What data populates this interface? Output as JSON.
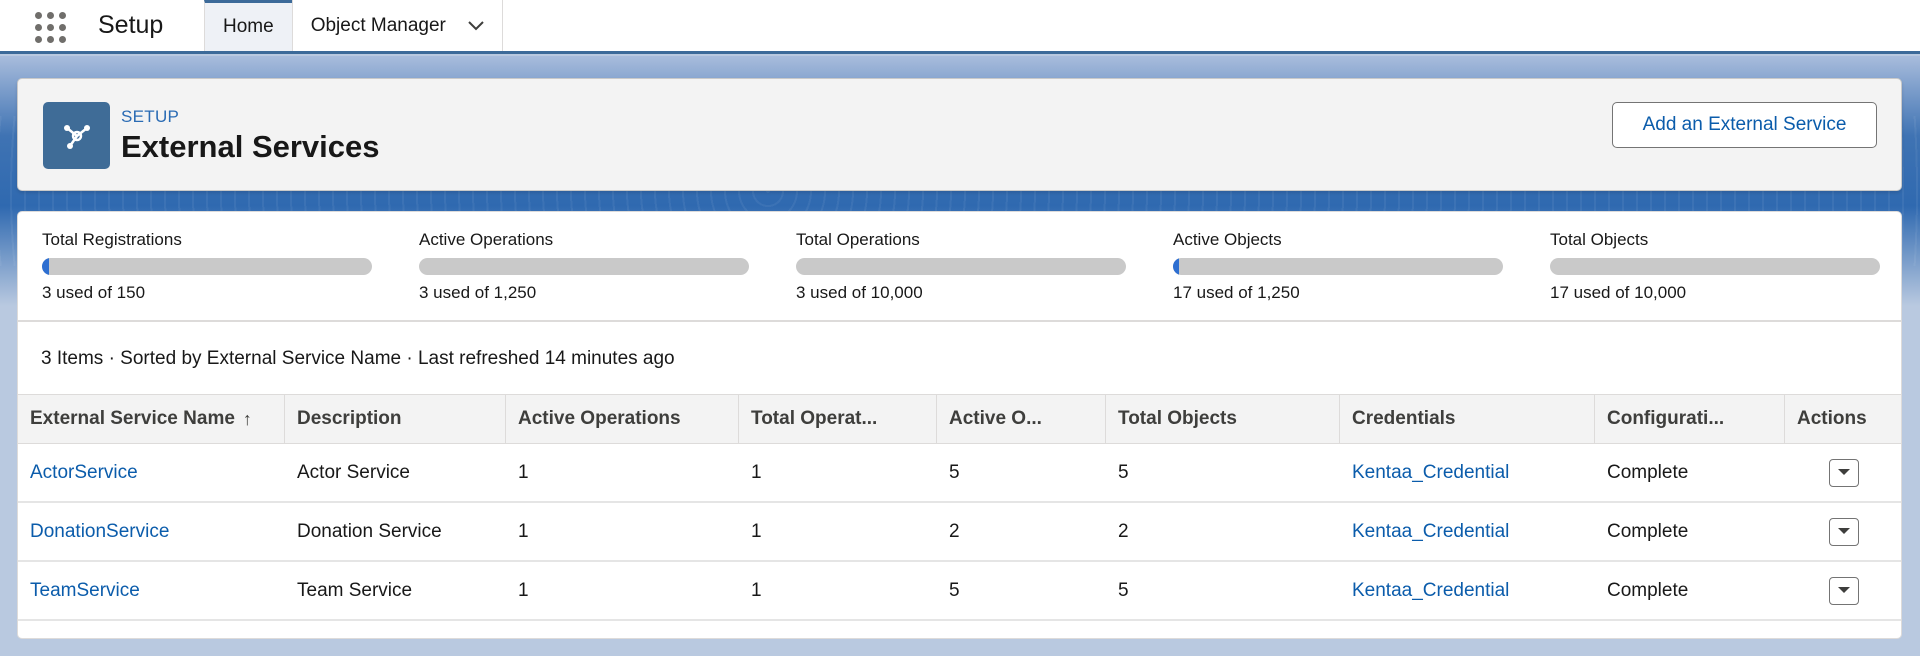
{
  "nav": {
    "app_name": "Setup",
    "tabs": [
      {
        "label": "Home",
        "active": true
      },
      {
        "label": "Object Manager",
        "active": false
      }
    ]
  },
  "header": {
    "eyebrow": "SETUP",
    "title": "External Services",
    "icon": "external-services-icon",
    "add_button": "Add an External Service"
  },
  "usage": [
    {
      "label": "Total Registrations",
      "value_text": "3 used of 150",
      "used": 3,
      "limit": 150
    },
    {
      "label": "Active Operations",
      "value_text": "3  used of 1,250",
      "used": 3,
      "limit": 1250
    },
    {
      "label": "Total Operations",
      "value_text": "3  used of 10,000",
      "used": 3,
      "limit": 10000
    },
    {
      "label": "Active Objects",
      "value_text": "17 used of 1,250",
      "used": 17,
      "limit": 1250
    },
    {
      "label": "Total Objects",
      "value_text": "17 used of 10,000",
      "used": 17,
      "limit": 10000
    }
  ],
  "list_info": "3 Items · Sorted by External Service Name · Last refreshed 14 minutes ago",
  "table": {
    "columns": [
      "External Service Name",
      "Description",
      "Active Operations",
      "Total Operat...",
      "Active O...",
      "Total Objects",
      "Credentials",
      "Configurati...",
      "Actions"
    ],
    "sort_indicator": "↑",
    "rows": [
      {
        "name": "ActorService",
        "description": "Actor Service",
        "active_operations": "1",
        "total_operations": "1",
        "active_objects": "5",
        "total_objects": "5",
        "credentials": "Kentaa_Credential",
        "configuration": "Complete"
      },
      {
        "name": "DonationService",
        "description": "Donation Service",
        "active_operations": "1",
        "total_operations": "1",
        "active_objects": "2",
        "total_objects": "2",
        "credentials": "Kentaa_Credential",
        "configuration": "Complete"
      },
      {
        "name": "TeamService",
        "description": "Team Service",
        "active_operations": "1",
        "total_operations": "1",
        "active_objects": "5",
        "total_objects": "5",
        "credentials": "Kentaa_Credential",
        "configuration": "Complete"
      }
    ]
  },
  "colors": {
    "brand": "#3f6c97",
    "link": "#0b5cab",
    "progress_fill": "#2e6fd1",
    "progress_track": "#c9c9c9"
  }
}
